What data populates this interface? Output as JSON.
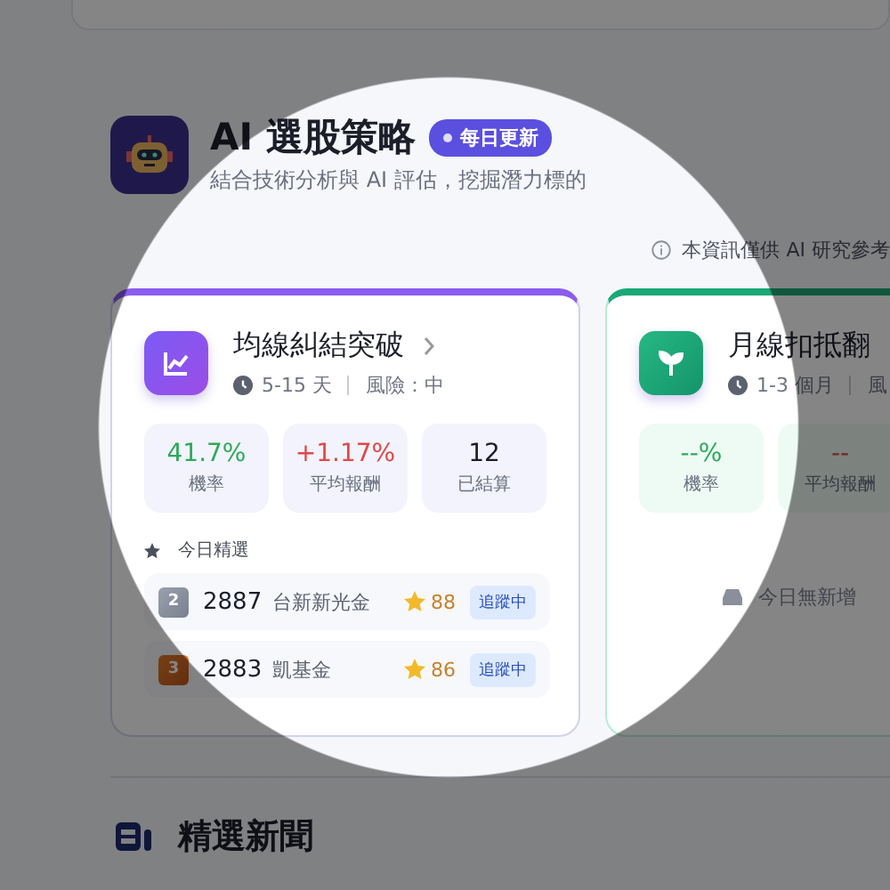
{
  "section": {
    "title": "AI 選股策略",
    "badge": "每日更新",
    "subtitle": "結合技術分析與 AI 評估，挖掘潛力標的",
    "disclaimer": "本資訊僅供 AI 研究參考"
  },
  "strategies": [
    {
      "kind": "trend",
      "name": "均線糾結突破",
      "period": "5-15 天",
      "risk": "風險：中",
      "stats": [
        {
          "kind": "rate",
          "value": "41.7%",
          "label": "機率"
        },
        {
          "kind": "return",
          "value": "+1.17%",
          "label": "平均報酬"
        },
        {
          "kind": "count",
          "value": "12",
          "label": "已結算"
        }
      ],
      "picks_title": "今日精選",
      "picks": [
        {
          "rank": "2",
          "kind": "silver",
          "code": "2887",
          "name": "台新新光金",
          "score": "88",
          "tag": "追蹤中"
        },
        {
          "rank": "3",
          "kind": "bronze",
          "code": "2883",
          "name": "凱基金",
          "score": "86",
          "tag": "追蹤中"
        }
      ]
    },
    {
      "kind": "sprout",
      "name": "月線扣抵翻",
      "period": "1-3 個月",
      "risk": "風",
      "stats": [
        {
          "kind": "rate",
          "value": "--%",
          "label": "機率"
        },
        {
          "kind": "return",
          "value": "--",
          "label": "平均報酬"
        }
      ],
      "empty": "今日無新增"
    }
  ],
  "news": {
    "title": "精選新聞"
  }
}
